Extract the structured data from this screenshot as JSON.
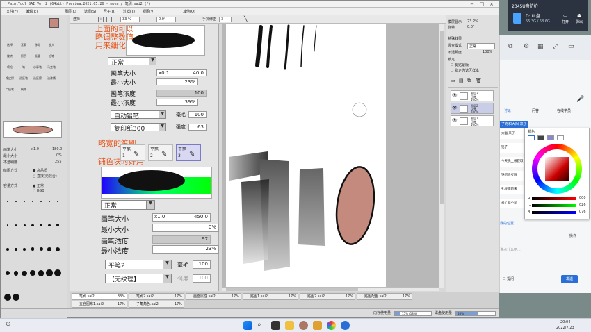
{
  "window": {
    "title": "PaintTool SAI Ver.2 (64bit) Preview.2021.05.20 - mona / 笔刷.sai2 (*)",
    "min": "−",
    "max": "□",
    "close": "×"
  },
  "menu": [
    "文件(F)",
    "编辑(E)",
    "图层(L)",
    "选择(S)",
    "尺子(R)",
    "过滤(T)",
    "视图(V)",
    "其他(O)"
  ],
  "toolbar": {
    "select_label": "选择",
    "zoom": "33 %",
    "angle": "0.0°",
    "stabilizer_label": "手抖修正",
    "stabilizer_value": "3"
  },
  "left_panel": {
    "color_swatch": "#c48a7e",
    "tools": [
      "选择",
      "套索",
      "移动",
      "放大",
      "旋转",
      "抓手",
      "吸管",
      "铅笔",
      "喷枪",
      "笔",
      "水彩笔",
      "马克笔",
      "橡皮擦",
      "选区笔",
      "选区擦",
      "油漆桶",
      "二值笔",
      "模糊"
    ],
    "brush_size_label": "画笔大小",
    "brush_size_value": "x1.0",
    "brush_size_num": "180.0",
    "min_size_label": "最小大小",
    "min_size_value": "0%",
    "opacity_label": "不透明度",
    "opacity_value": "255",
    "blend_label": "绘图方式",
    "blend_opt1": "高品质",
    "blend_opt2": "直接(无混合)",
    "mode_label": "容量方式",
    "mode_opt1": "正常",
    "mode_opt2": "RGB",
    "dot_sizes": [
      "0.7",
      "0.8",
      "1",
      "1.5",
      "2",
      "2.3",
      "2.6",
      "3",
      "3.5",
      "4",
      "5",
      "6",
      "7",
      "8",
      "9",
      "10",
      "12",
      "14",
      "16",
      "20",
      "25",
      "30",
      "35",
      "40",
      "50",
      "60",
      "70",
      "80",
      "100",
      "120"
    ]
  },
  "brush_panel": {
    "annotation_top_1": "上面的可以",
    "annotation_top_2": "略调整数值",
    "annotation_top_3": "用来细化",
    "upper": {
      "mode": "正常",
      "size_label": "画笔大小",
      "size_mult": "x0.1",
      "size_value": "40.0",
      "min_label": "最小大小",
      "min_value": "23%",
      "density_label": "画笔浓度",
      "density_value": "100",
      "min_density_label": "最小浓度",
      "min_density_value": "39%",
      "brush_shape": "自动铅笔",
      "shape_tag": "毫毛",
      "shape_value": "100",
      "texture": "复印纸300",
      "texture_tag": "强度",
      "texture_value": "63"
    },
    "annotation_mid_1": "略宽的笔刷",
    "annotation_mid_2": "铺色块时好用",
    "brush_slots": [
      {
        "label": "平笔",
        "num": "1"
      },
      {
        "label": "平笔",
        "num": "2"
      },
      {
        "label": "平笔",
        "num": "3"
      }
    ],
    "lower": {
      "mode": "正常",
      "size_label": "画笔大小",
      "size_mult": "x1.0",
      "size_value": "450.0",
      "min_label": "最小大小",
      "min_value": "0%",
      "density_label": "画笔浓度",
      "density_value": "97",
      "min_density_label": "最小浓度",
      "min_density_value": "23%",
      "brush_shape": "平笔2",
      "shape_tag": "毫毛",
      "shape_value": "100",
      "texture": "【无纹理】",
      "texture_tag": "强度",
      "texture_value": "100"
    }
  },
  "right_panel": {
    "opacity_label": "模层显示",
    "opacity_value": "23.2%",
    "angle_label": "旋转",
    "angle_value": "0.0°",
    "blend_section": "特殊效果",
    "blend_mode_label": "混合模式",
    "blend_mode_value": "正常",
    "layer_opacity_label": "不透明度",
    "layer_opacity_value": "100%",
    "lock_label": "锁定",
    "clip_label": "剪贴蒙版",
    "ref_label": "指定为选区样本",
    "layers": [
      {
        "name": "图层3",
        "mode": "正常",
        "opacity": "100%"
      },
      {
        "name": "图层2",
        "mode": "正常",
        "opacity": "100%"
      },
      {
        "name": "图层1",
        "mode": "正常",
        "opacity": "100%"
      }
    ]
  },
  "file_tabs": [
    {
      "name": "笔刷.sai2",
      "zoom": "33%"
    },
    {
      "name": "笔刷2.sai2",
      "zoom": "17%"
    },
    {
      "name": "画面属性.sai2",
      "zoom": "17%"
    },
    {
      "name": "贴图1.sai2",
      "zoom": "17%"
    },
    {
      "name": "贴图2.sai2",
      "zoom": "17%"
    },
    {
      "name": "贴图配色.sai2",
      "zoom": "17%"
    },
    {
      "name": "五官图布1.sai2",
      "zoom": "17%"
    },
    {
      "name": "子角角色.sai2",
      "zoom": "17%"
    }
  ],
  "status": {
    "memory_label": "内存使用量",
    "memory_value": "15% (18%)",
    "disk_label": "磁盘使用量",
    "disk_value": "58%"
  },
  "usb_popup": {
    "header": "2345U盘防护",
    "drive_label": "D: U 盘",
    "capacity": "55.3G / 58.6G",
    "open_label": "打开",
    "eject_label": "弹出"
  },
  "chat": {
    "tab_discuss": "讨论",
    "tab_qa": "问答",
    "tab_online": "在线学员",
    "highlight_msg": "了克和大阳 来了",
    "msgs": [
      "大幽 来了",
      "铛子 ",
      "今天晚上被获取",
      "铛何思考喔",
      "孔楼面新来",
      "来了就不是"
    ],
    "pos_label": "我的位置",
    "input_placeholder": "说点什么吧...",
    "send_label": "发送",
    "hint_label": "提问",
    "op_label": "操作"
  },
  "color_picker": {
    "title": "颜色",
    "r_label": "R",
    "r_value": "000",
    "g_label": "G",
    "g_value": "026",
    "b_label": "B",
    "b_value": "076"
  },
  "taskbar": {
    "time": "20:04",
    "date": "2022/7/23"
  }
}
